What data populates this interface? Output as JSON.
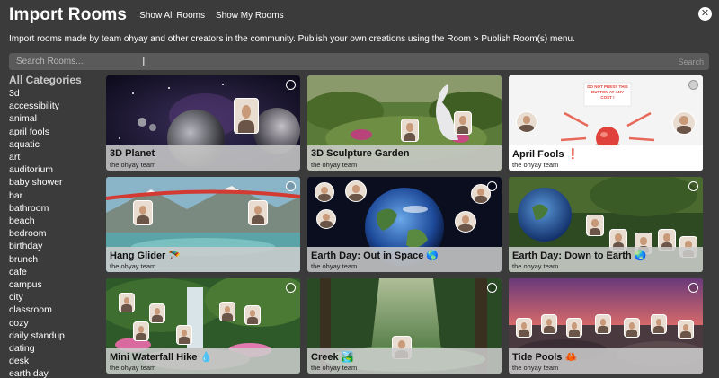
{
  "header": {
    "title": "Import Rooms",
    "links": [
      "Show All Rooms",
      "Show My Rooms"
    ]
  },
  "description": "Import rooms made by team ohyay and other creators in the community. Publish your own creations using the Room > Publish Room(s) menu.",
  "search": {
    "placeholder": "Search Rooms...",
    "button_label": "Search"
  },
  "sidebar": {
    "heading": "All Categories",
    "items": [
      "3d",
      "accessibility",
      "animal",
      "april fools",
      "aquatic",
      "art",
      "auditorium",
      "baby shower",
      "bar",
      "bathroom",
      "beach",
      "bedroom",
      "birthday",
      "brunch",
      "cafe",
      "campus",
      "city",
      "classroom",
      "cozy",
      "daily standup",
      "dating",
      "desk",
      "earth day"
    ]
  },
  "cards": [
    {
      "title": "3D Planet",
      "author": "the ohyay team"
    },
    {
      "title": "3D Sculpture Garden",
      "author": "the ohyay team"
    },
    {
      "title": "April Fools ❗",
      "author": "the ohyay team",
      "sign_text": "DO NOT PRESS THIS BUTTON AT ANY COST !"
    },
    {
      "title": "Hang Glider 🪂",
      "author": "the ohyay team"
    },
    {
      "title": "Earth Day: Out in Space 🌎",
      "author": "the ohyay team"
    },
    {
      "title": "Earth Day: Down to Earth 🌏",
      "author": "the ohyay team"
    },
    {
      "title": "Mini Waterfall Hike 💧",
      "author": "the ohyay team"
    },
    {
      "title": "Creek 🏞️",
      "author": "the ohyay team"
    },
    {
      "title": "Tide Pools 🦀",
      "author": "the ohyay team"
    }
  ],
  "colors": {
    "background": "#3b3b3b",
    "search_bg": "#5a5a5a",
    "card_footer": "#cdcdcd",
    "april_button": "#e0413a"
  }
}
